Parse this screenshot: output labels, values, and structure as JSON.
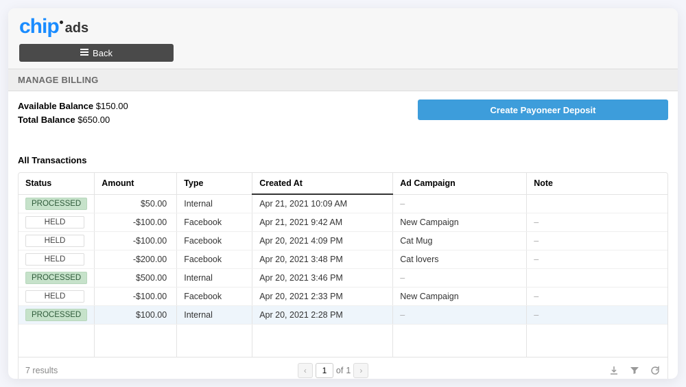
{
  "logo": {
    "chip": "chip",
    "ads": "ads"
  },
  "back_label": "Back",
  "panel_title": "MANAGE BILLING",
  "balances": {
    "available_label": "Available Balance",
    "available_value": "$150.00",
    "total_label": "Total Balance",
    "total_value": "$650.00"
  },
  "deposit_label": "Create Payoneer Deposit",
  "section_title": "All Transactions",
  "columns": {
    "status": "Status",
    "amount": "Amount",
    "type": "Type",
    "created": "Created At",
    "campaign": "Ad Campaign",
    "note": "Note"
  },
  "rows": [
    {
      "status": "PROCESSED",
      "amount": "$50.00",
      "type": "Internal",
      "created": "Apr 21, 2021 10:09 AM",
      "campaign": "–",
      "note": "",
      "selected": false
    },
    {
      "status": "HELD",
      "amount": "-$100.00",
      "type": "Facebook",
      "created": "Apr 21, 2021 9:42 AM",
      "campaign": "New Campaign",
      "note": "–",
      "selected": false
    },
    {
      "status": "HELD",
      "amount": "-$100.00",
      "type": "Facebook",
      "created": "Apr 20, 2021 4:09 PM",
      "campaign": "Cat Mug",
      "note": "–",
      "selected": false
    },
    {
      "status": "HELD",
      "amount": "-$200.00",
      "type": "Facebook",
      "created": "Apr 20, 2021 3:48 PM",
      "campaign": "Cat lovers",
      "note": "–",
      "selected": false
    },
    {
      "status": "PROCESSED",
      "amount": "$500.00",
      "type": "Internal",
      "created": "Apr 20, 2021 3:46 PM",
      "campaign": "–",
      "note": "",
      "selected": false
    },
    {
      "status": "HELD",
      "amount": "-$100.00",
      "type": "Facebook",
      "created": "Apr 20, 2021 2:33 PM",
      "campaign": "New Campaign",
      "note": "–",
      "selected": false
    },
    {
      "status": "PROCESSED",
      "amount": "$100.00",
      "type": "Internal",
      "created": "Apr 20, 2021 2:28 PM",
      "campaign": "–",
      "note": "–",
      "selected": true
    }
  ],
  "footer": {
    "results": "7 results",
    "page_value": "1",
    "of_label": "of",
    "total_pages": "1"
  }
}
